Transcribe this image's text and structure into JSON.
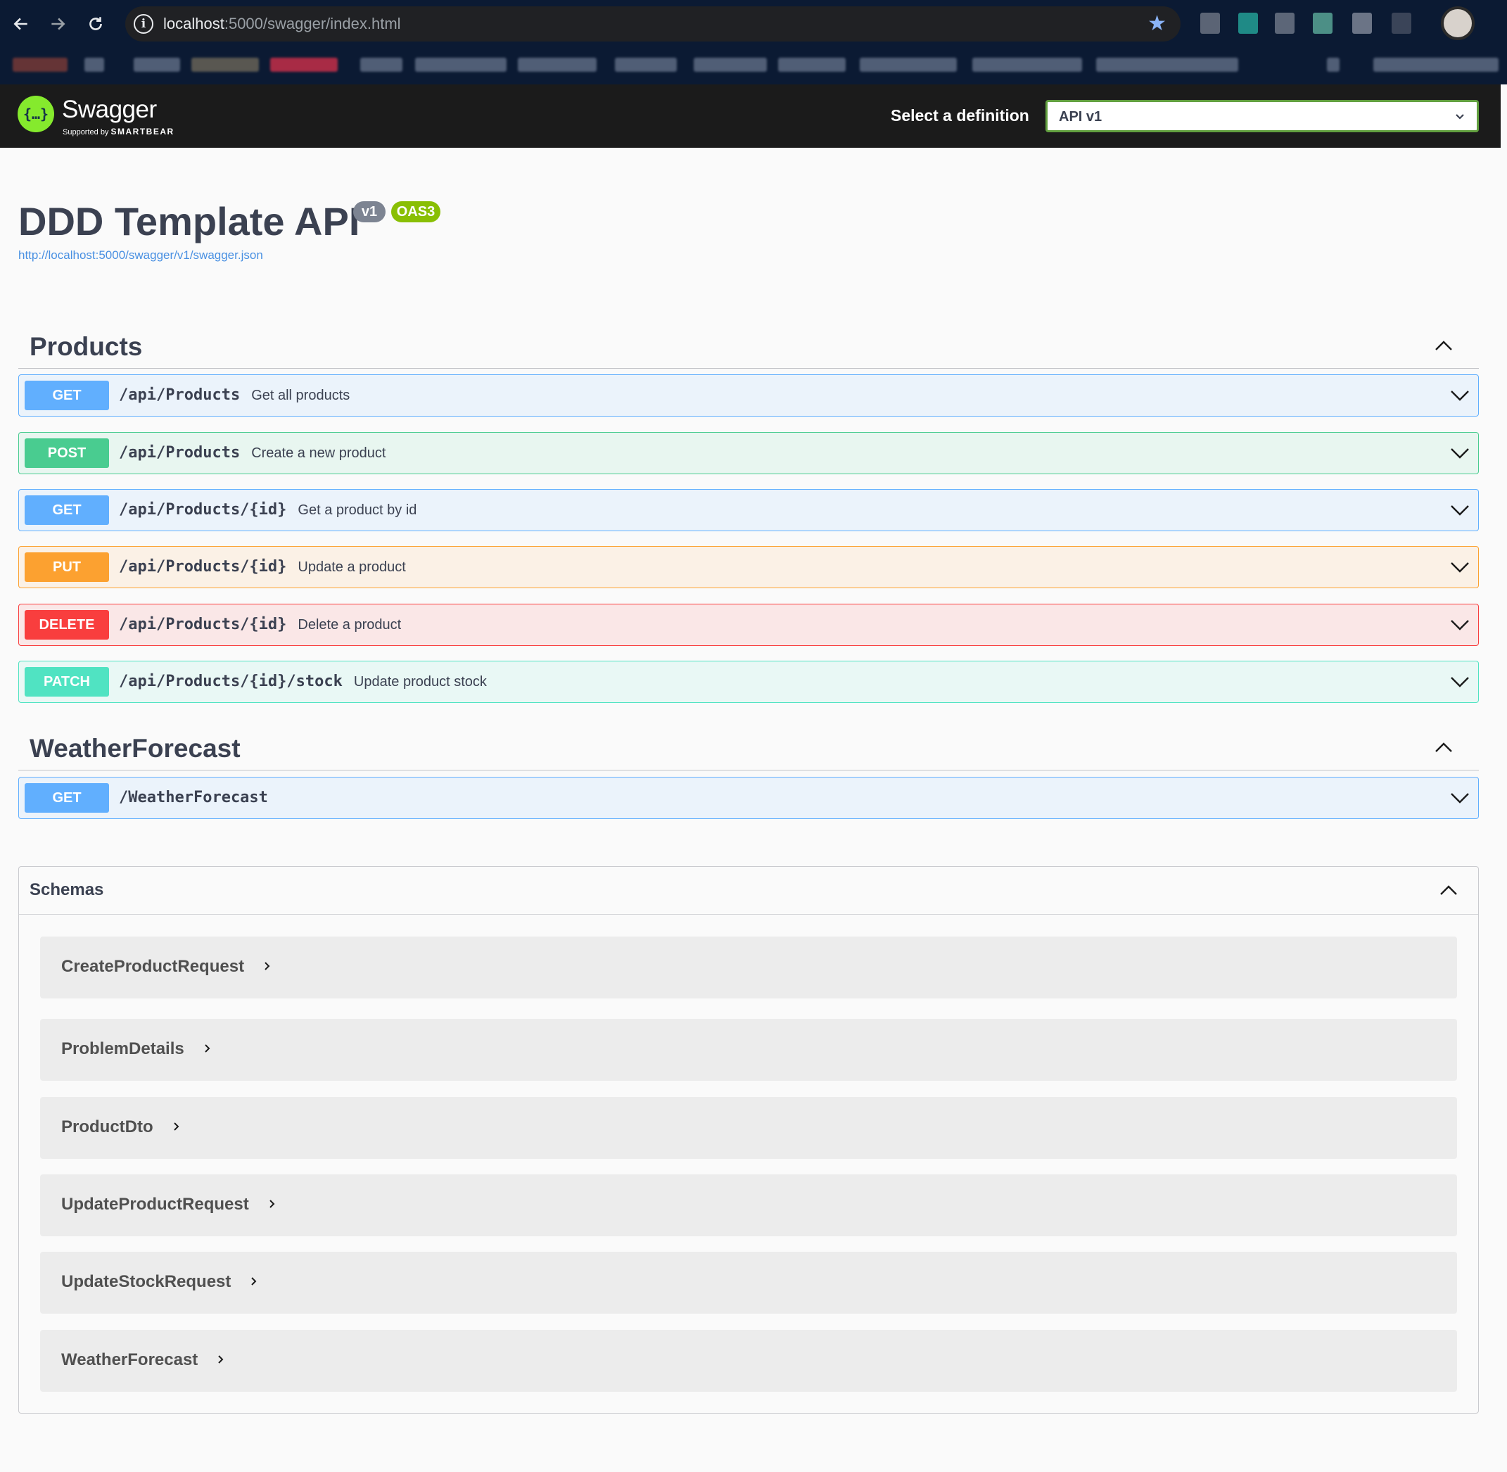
{
  "browser": {
    "url_host": "localhost",
    "url_path": ":5000/swagger/index.html"
  },
  "topbar": {
    "logo_text": "Swagger",
    "logo_subtitle_small": "Supported by",
    "logo_subtitle_brand": "SMARTBEAR",
    "definition_label": "Select a definition",
    "definition_value": "API v1"
  },
  "info": {
    "title": "DDD Template API",
    "version_badge": "v1",
    "oas_badge": "OAS3",
    "spec_url": "http://localhost:5000/swagger/v1/swagger.json"
  },
  "tags": [
    {
      "name": "Products",
      "operations": [
        {
          "method": "GET",
          "path": "/api/Products",
          "summary": "Get all products"
        },
        {
          "method": "POST",
          "path": "/api/Products",
          "summary": "Create a new product"
        },
        {
          "method": "GET",
          "path": "/api/Products/{id}",
          "summary": "Get a product by id"
        },
        {
          "method": "PUT",
          "path": "/api/Products/{id}",
          "summary": "Update a product"
        },
        {
          "method": "DELETE",
          "path": "/api/Products/{id}",
          "summary": "Delete a product"
        },
        {
          "method": "PATCH",
          "path": "/api/Products/{id}/stock",
          "summary": "Update product stock"
        }
      ]
    },
    {
      "name": "WeatherForecast",
      "operations": [
        {
          "method": "GET",
          "path": "/WeatherForecast",
          "summary": ""
        }
      ]
    }
  ],
  "schemas": {
    "title": "Schemas",
    "models": [
      "CreateProductRequest",
      "ProblemDetails",
      "ProductDto",
      "UpdateProductRequest",
      "UpdateStockRequest",
      "WeatherForecast"
    ]
  },
  "colors": {
    "get": "#61affe",
    "post": "#49cc90",
    "put": "#fca130",
    "delete": "#f93e3e",
    "patch": "#50e3c2",
    "swagger_green": "#85ea2d",
    "topbar": "#1b1b1b"
  },
  "icons": {
    "back": "arrow-left-icon",
    "forward": "arrow-right-icon",
    "reload": "reload-icon",
    "site_info": "info-icon",
    "bookmark": "star-icon",
    "expand": "chevron-down-icon",
    "collapse": "chevron-up-icon",
    "model_expand": "chevron-right-icon"
  }
}
